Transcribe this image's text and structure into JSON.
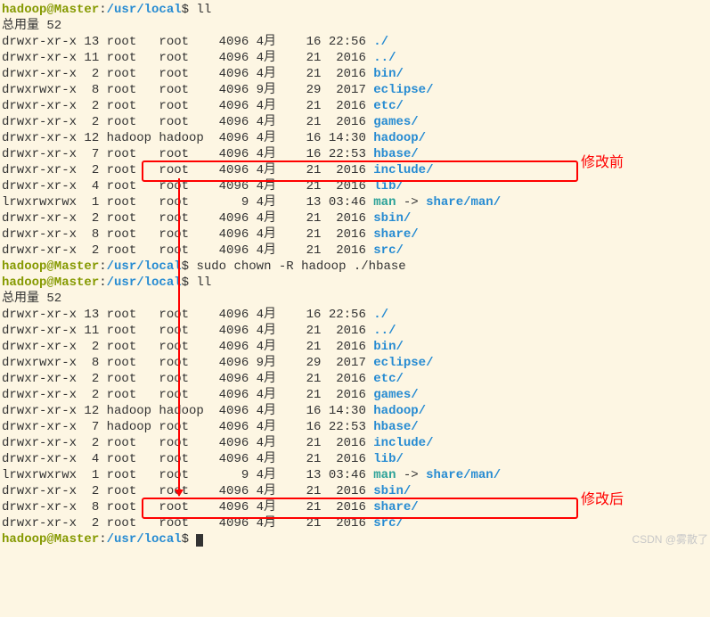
{
  "prompt_prefix": {
    "user_host": "hadoop@Master",
    "colon": ":",
    "path": "/usr/local",
    "dollar": "$"
  },
  "cmd1": "ll",
  "total1": "总用量 52",
  "list1": [
    {
      "perm": "drwxr-xr-x",
      "lnk": "13",
      "owner": "root",
      "group": "root",
      "size": "4096",
      "month": "4月",
      "day": "16",
      "time": "22:56",
      "name": "./",
      "type": "dir"
    },
    {
      "perm": "drwxr-xr-x",
      "lnk": "11",
      "owner": "root",
      "group": "root",
      "size": "4096",
      "month": "4月",
      "day": "21",
      "time": "2016",
      "name": "../",
      "type": "dir"
    },
    {
      "perm": "drwxr-xr-x",
      "lnk": "2",
      "owner": "root",
      "group": "root",
      "size": "4096",
      "month": "4月",
      "day": "21",
      "time": "2016",
      "name": "bin/",
      "type": "dir"
    },
    {
      "perm": "drwxrwxr-x",
      "lnk": "8",
      "owner": "root",
      "group": "root",
      "size": "4096",
      "month": "9月",
      "day": "29",
      "time": "2017",
      "name": "eclipse/",
      "type": "dir"
    },
    {
      "perm": "drwxr-xr-x",
      "lnk": "2",
      "owner": "root",
      "group": "root",
      "size": "4096",
      "month": "4月",
      "day": "21",
      "time": "2016",
      "name": "etc/",
      "type": "dir"
    },
    {
      "perm": "drwxr-xr-x",
      "lnk": "2",
      "owner": "root",
      "group": "root",
      "size": "4096",
      "month": "4月",
      "day": "21",
      "time": "2016",
      "name": "games/",
      "type": "dir"
    },
    {
      "perm": "drwxr-xr-x",
      "lnk": "12",
      "owner": "hadoop",
      "group": "hadoop",
      "size": "4096",
      "month": "4月",
      "day": "16",
      "time": "14:30",
      "name": "hadoop/",
      "type": "dir"
    },
    {
      "perm": "drwxr-xr-x",
      "lnk": "7",
      "owner": "root",
      "group": "root",
      "size": "4096",
      "month": "4月",
      "day": "16",
      "time": "22:53",
      "name": "hbase/",
      "type": "dir"
    },
    {
      "perm": "drwxr-xr-x",
      "lnk": "2",
      "owner": "root",
      "group": "root",
      "size": "4096",
      "month": "4月",
      "day": "21",
      "time": "2016",
      "name": "include/",
      "type": "dir"
    },
    {
      "perm": "drwxr-xr-x",
      "lnk": "4",
      "owner": "root",
      "group": "root",
      "size": "4096",
      "month": "4月",
      "day": "21",
      "time": "2016",
      "name": "lib/",
      "type": "dir"
    },
    {
      "perm": "lrwxrwxrwx",
      "lnk": "1",
      "owner": "root",
      "group": "root",
      "size": "9",
      "month": "4月",
      "day": "13",
      "time": "03:46",
      "name": "man",
      "type": "link",
      "target": "share/man/"
    },
    {
      "perm": "drwxr-xr-x",
      "lnk": "2",
      "owner": "root",
      "group": "root",
      "size": "4096",
      "month": "4月",
      "day": "21",
      "time": "2016",
      "name": "sbin/",
      "type": "dir"
    },
    {
      "perm": "drwxr-xr-x",
      "lnk": "8",
      "owner": "root",
      "group": "root",
      "size": "4096",
      "month": "4月",
      "day": "21",
      "time": "2016",
      "name": "share/",
      "type": "dir"
    },
    {
      "perm": "drwxr-xr-x",
      "lnk": "2",
      "owner": "root",
      "group": "root",
      "size": "4096",
      "month": "4月",
      "day": "21",
      "time": "2016",
      "name": "src/",
      "type": "dir"
    }
  ],
  "cmd2": "sudo chown -R hadoop ./hbase",
  "cmd3": "ll",
  "total2": "总用量 52",
  "list2": [
    {
      "perm": "drwxr-xr-x",
      "lnk": "13",
      "owner": "root",
      "group": "root",
      "size": "4096",
      "month": "4月",
      "day": "16",
      "time": "22:56",
      "name": "./",
      "type": "dir"
    },
    {
      "perm": "drwxr-xr-x",
      "lnk": "11",
      "owner": "root",
      "group": "root",
      "size": "4096",
      "month": "4月",
      "day": "21",
      "time": "2016",
      "name": "../",
      "type": "dir"
    },
    {
      "perm": "drwxr-xr-x",
      "lnk": "2",
      "owner": "root",
      "group": "root",
      "size": "4096",
      "month": "4月",
      "day": "21",
      "time": "2016",
      "name": "bin/",
      "type": "dir"
    },
    {
      "perm": "drwxrwxr-x",
      "lnk": "8",
      "owner": "root",
      "group": "root",
      "size": "4096",
      "month": "9月",
      "day": "29",
      "time": "2017",
      "name": "eclipse/",
      "type": "dir"
    },
    {
      "perm": "drwxr-xr-x",
      "lnk": "2",
      "owner": "root",
      "group": "root",
      "size": "4096",
      "month": "4月",
      "day": "21",
      "time": "2016",
      "name": "etc/",
      "type": "dir"
    },
    {
      "perm": "drwxr-xr-x",
      "lnk": "2",
      "owner": "root",
      "group": "root",
      "size": "4096",
      "month": "4月",
      "day": "21",
      "time": "2016",
      "name": "games/",
      "type": "dir"
    },
    {
      "perm": "drwxr-xr-x",
      "lnk": "12",
      "owner": "hadoop",
      "group": "hadoop",
      "size": "4096",
      "month": "4月",
      "day": "16",
      "time": "14:30",
      "name": "hadoop/",
      "type": "dir"
    },
    {
      "perm": "drwxr-xr-x",
      "lnk": "7",
      "owner": "hadoop",
      "group": "root",
      "size": "4096",
      "month": "4月",
      "day": "16",
      "time": "22:53",
      "name": "hbase/",
      "type": "dir"
    },
    {
      "perm": "drwxr-xr-x",
      "lnk": "2",
      "owner": "root",
      "group": "root",
      "size": "4096",
      "month": "4月",
      "day": "21",
      "time": "2016",
      "name": "include/",
      "type": "dir"
    },
    {
      "perm": "drwxr-xr-x",
      "lnk": "4",
      "owner": "root",
      "group": "root",
      "size": "4096",
      "month": "4月",
      "day": "21",
      "time": "2016",
      "name": "lib/",
      "type": "dir"
    },
    {
      "perm": "lrwxrwxrwx",
      "lnk": "1",
      "owner": "root",
      "group": "root",
      "size": "9",
      "month": "4月",
      "day": "13",
      "time": "03:46",
      "name": "man",
      "type": "link",
      "target": "share/man/"
    },
    {
      "perm": "drwxr-xr-x",
      "lnk": "2",
      "owner": "root",
      "group": "root",
      "size": "4096",
      "month": "4月",
      "day": "21",
      "time": "2016",
      "name": "sbin/",
      "type": "dir"
    },
    {
      "perm": "drwxr-xr-x",
      "lnk": "8",
      "owner": "root",
      "group": "root",
      "size": "4096",
      "month": "4月",
      "day": "21",
      "time": "2016",
      "name": "share/",
      "type": "dir"
    },
    {
      "perm": "drwxr-xr-x",
      "lnk": "2",
      "owner": "root",
      "group": "root",
      "size": "4096",
      "month": "4月",
      "day": "21",
      "time": "2016",
      "name": "src/",
      "type": "dir"
    }
  ],
  "annotations": {
    "before": "修改前",
    "after": "修改后"
  },
  "watermark": "CSDN @雾散了"
}
